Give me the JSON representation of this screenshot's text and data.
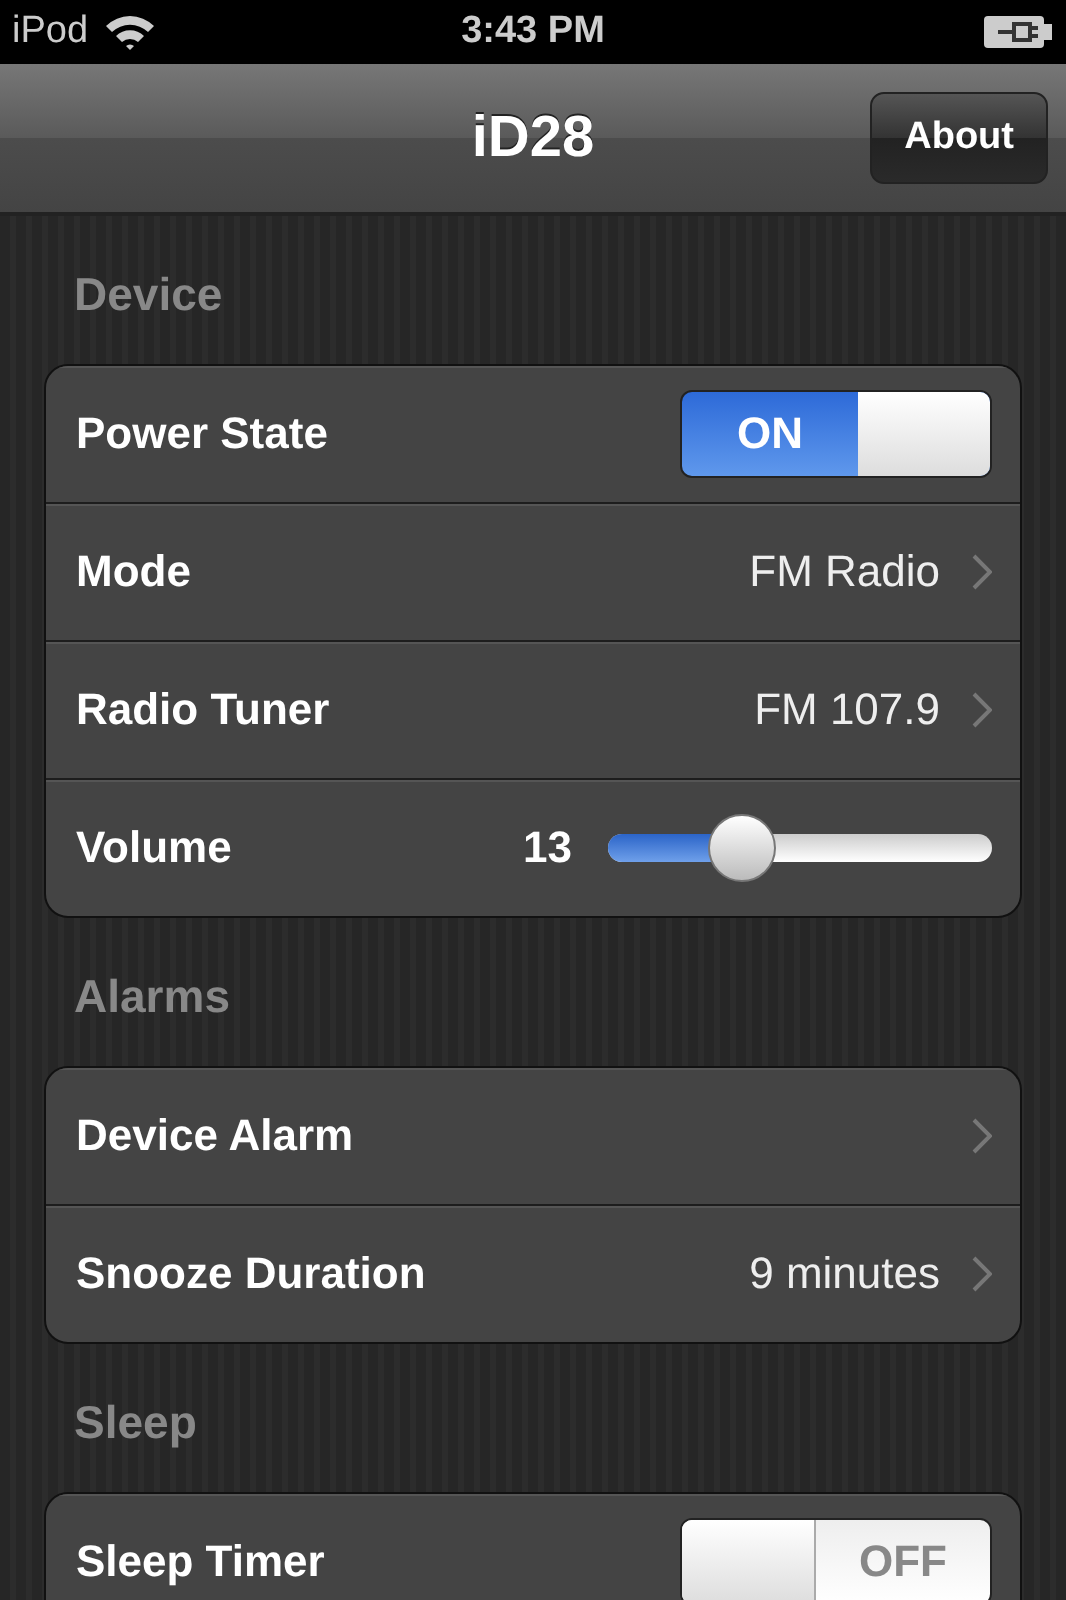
{
  "status_bar": {
    "carrier": "iPod",
    "time": "3:43 PM"
  },
  "nav_bar": {
    "title": "iD28",
    "button": "About"
  },
  "sections": [
    {
      "title": "Device",
      "rows": [
        {
          "kind": "toggle",
          "label": "Power State",
          "on": true,
          "toggle_text": "ON"
        },
        {
          "kind": "disclosure",
          "label": "Mode",
          "value": "FM Radio"
        },
        {
          "kind": "disclosure",
          "label": "Radio Tuner",
          "value": "FM 107.9"
        },
        {
          "kind": "slider",
          "label": "Volume",
          "value": "13",
          "level": 0.35
        }
      ]
    },
    {
      "title": "Alarms",
      "rows": [
        {
          "kind": "disclosure",
          "label": "Device Alarm"
        },
        {
          "kind": "disclosure",
          "label": "Snooze Duration",
          "value": "9 minutes"
        }
      ]
    },
    {
      "title": "Sleep",
      "rows": [
        {
          "kind": "toggle",
          "label": "Sleep Timer",
          "on": false,
          "toggle_text": "OFF"
        }
      ]
    }
  ]
}
